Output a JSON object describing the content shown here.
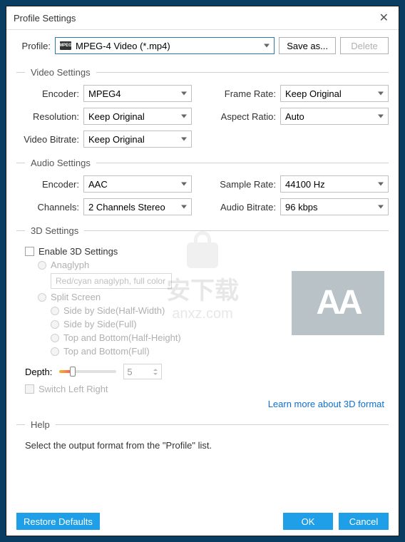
{
  "titlebar": {
    "title": "Profile Settings"
  },
  "profile": {
    "label": "Profile:",
    "value": "MPEG-4 Video (*.mp4)",
    "save_as": "Save as...",
    "delete": "Delete",
    "icon_text": "MPEG"
  },
  "video": {
    "title": "Video Settings",
    "encoder_label": "Encoder:",
    "encoder": "MPEG4",
    "resolution_label": "Resolution:",
    "resolution": "Keep Original",
    "bitrate_label": "Video Bitrate:",
    "bitrate": "Keep Original",
    "framerate_label": "Frame Rate:",
    "framerate": "Keep Original",
    "aspect_label": "Aspect Ratio:",
    "aspect": "Auto"
  },
  "audio": {
    "title": "Audio Settings",
    "encoder_label": "Encoder:",
    "encoder": "AAC",
    "channels_label": "Channels:",
    "channels": "2 Channels Stereo",
    "samplerate_label": "Sample Rate:",
    "samplerate": "44100 Hz",
    "bitrate_label": "Audio Bitrate:",
    "bitrate": "96 kbps"
  },
  "d3": {
    "title": "3D Settings",
    "enable": "Enable 3D Settings",
    "anaglyph": "Anaglyph",
    "anaglyph_ph": "Red/cyan anaglyph, full color",
    "split": "Split Screen",
    "sbs_half": "Side by Side(Half-Width)",
    "sbs_full": "Side by Side(Full)",
    "tb_half": "Top and Bottom(Half-Height)",
    "tb_full": "Top and Bottom(Full)",
    "depth_label": "Depth:",
    "depth_value": "5",
    "switch": "Switch Left Right",
    "learn_more": "Learn more about 3D format",
    "preview": "AA"
  },
  "help": {
    "title": "Help",
    "text": "Select the output format from the \"Profile\" list."
  },
  "footer": {
    "restore": "Restore Defaults",
    "ok": "OK",
    "cancel": "Cancel"
  },
  "watermark": {
    "top": "安下载",
    "bottom": "anxz.com"
  }
}
